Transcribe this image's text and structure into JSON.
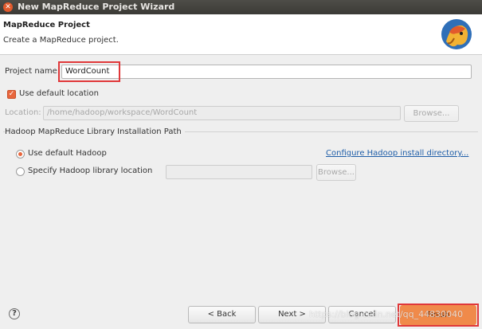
{
  "window": {
    "title": "New MapReduce Project Wizard"
  },
  "banner": {
    "title": "MapReduce Project",
    "description": "Create a MapReduce project."
  },
  "project": {
    "name_label": "Project name:",
    "name_value": "WordCount"
  },
  "location": {
    "use_default_label": "Use default location",
    "label": "Location:",
    "value": "/home/hadoop/workspace/WordCount",
    "browse_label": "Browse..."
  },
  "hadoop_group": {
    "title": "Hadoop MapReduce Library Installation Path",
    "use_default_label": "Use default Hadoop",
    "configure_link": "Configure Hadoop install directory...",
    "specify_label": "Specify Hadoop library location",
    "browse_label": "Browse..."
  },
  "footer": {
    "help": "?",
    "back_label": "< Back",
    "next_label": "Next >",
    "cancel_label": "Cancel",
    "finish_label": "Finish",
    "watermark": "https://blog.csdn.net/qq_44830040"
  },
  "colors": {
    "accent": "#e8663d",
    "highlight": "#e0383a",
    "link": "#1f5ea8"
  }
}
